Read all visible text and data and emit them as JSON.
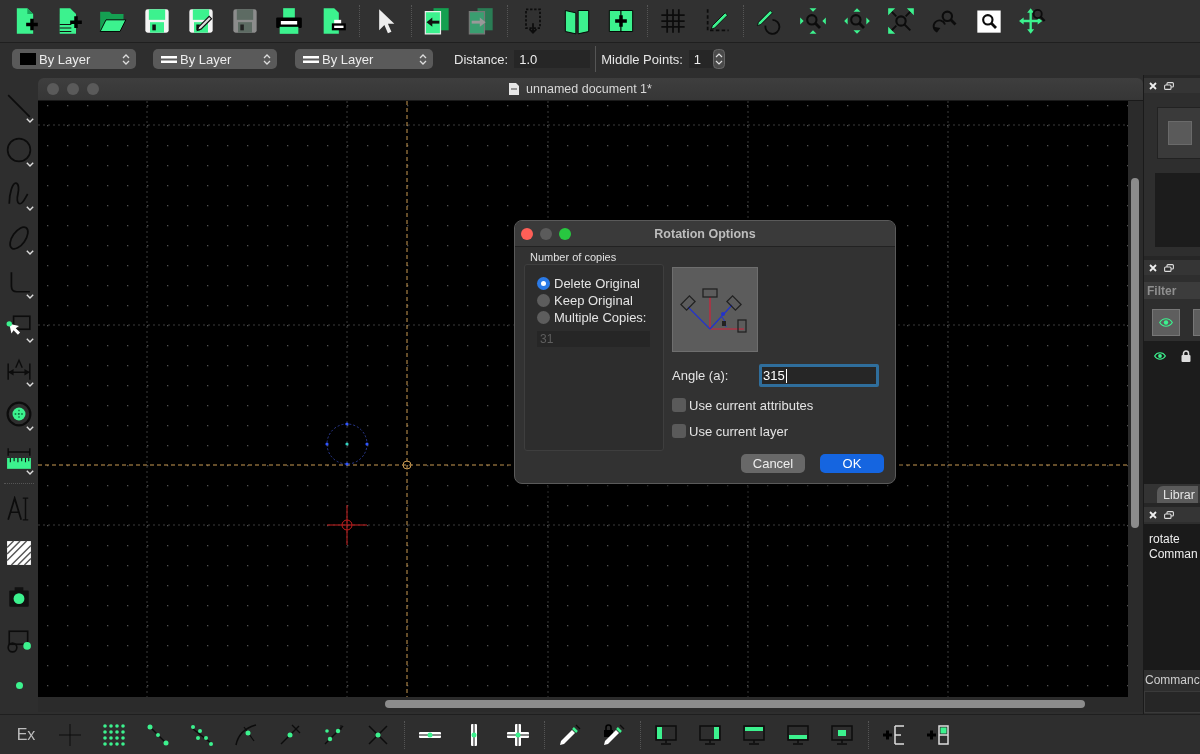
{
  "toolbar": {
    "color_select": {
      "value": "By Layer"
    },
    "width_select": {
      "value": "By Layer"
    },
    "linetype_select": {
      "value": "By Layer"
    },
    "distance": {
      "label": "Distance:",
      "value": "1.0"
    },
    "middle_points": {
      "label": "Middle Points:",
      "value": "1"
    }
  },
  "document_window": {
    "title": "unnamed document 1*"
  },
  "rotation_dialog": {
    "title": "Rotation Options",
    "copies_group": {
      "title": "Number of copies",
      "options": [
        {
          "label": "Delete Original",
          "selected": true
        },
        {
          "label": "Keep Original",
          "selected": false
        },
        {
          "label": "Multiple Copies:",
          "selected": false
        }
      ],
      "copies_field": {
        "value": "31",
        "disabled": true
      }
    },
    "angle": {
      "label": "Angle (a):",
      "value": "315",
      "focused": true
    },
    "checkboxes": [
      {
        "label": "Use current attributes",
        "checked": false
      },
      {
        "label": "Use current layer",
        "checked": false
      }
    ],
    "buttons": [
      {
        "label": "Cancel",
        "kind": "secondary"
      },
      {
        "label": "OK",
        "kind": "primary"
      }
    ]
  },
  "layer_panel": {
    "filter": {
      "placeholder": "Filter"
    },
    "tabs": [
      {
        "label": "Librar",
        "selected": false
      }
    ]
  },
  "command_panel": {
    "history": [
      "rotate",
      "Comman"
    ],
    "label": "Commanc"
  },
  "snap_toolbar": {
    "exclusive_label": "Ex"
  }
}
